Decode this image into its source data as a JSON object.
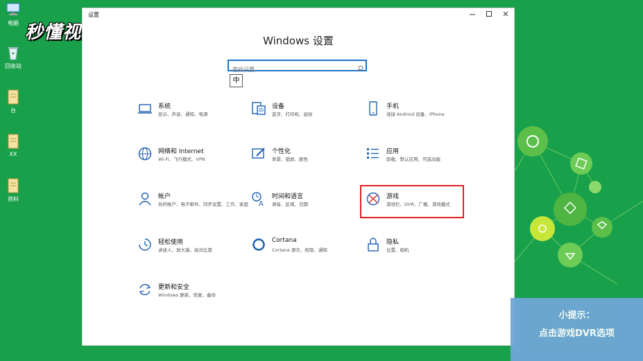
{
  "desktop": {
    "watermark": "秒懂视频",
    "icons": [
      {
        "label": "电脑"
      },
      {
        "label": "回收站"
      },
      {
        "label": "台"
      },
      {
        "label": "XX"
      },
      {
        "label": "资料"
      }
    ]
  },
  "window": {
    "title": "设置",
    "heading": "Windows 设置",
    "search_placeholder": "查找设置",
    "ime_indicator": "中",
    "items": [
      {
        "name": "系统",
        "desc": "显示、声音、通知、电源",
        "icon": "laptop-icon"
      },
      {
        "name": "设备",
        "desc": "蓝牙、打印机、鼠标",
        "icon": "keyboard-icon"
      },
      {
        "name": "手机",
        "desc": "连接 Android 设备、iPhone",
        "icon": "phone-icon"
      },
      {
        "name": "网络和 Internet",
        "desc": "Wi-Fi、飞行模式、VPN",
        "icon": "globe-icon"
      },
      {
        "name": "个性化",
        "desc": "背景、锁屏、颜色",
        "icon": "paint-icon"
      },
      {
        "name": "应用",
        "desc": "卸载、默认应用、可选功能",
        "icon": "apps-list-icon"
      },
      {
        "name": "帐户",
        "desc": "你的帐户、电子邮件、同步设置、工作、家庭",
        "icon": "person-icon"
      },
      {
        "name": "时间和语言",
        "desc": "语音、区域、日期",
        "icon": "time-language-icon"
      },
      {
        "name": "游戏",
        "desc": "游戏栏、DVR、广播、游戏模式",
        "icon": "xbox-icon"
      },
      {
        "name": "轻松使用",
        "desc": "讲述人、放大镜、高对比度",
        "icon": "ease-of-access-icon"
      },
      {
        "name": "Cortana",
        "desc": "Cortana 语言、权限、通知",
        "icon": "cortana-icon"
      },
      {
        "name": "隐私",
        "desc": "位置、相机",
        "icon": "lock-icon"
      },
      {
        "name": "更新和安全",
        "desc": "Windows 更新、恢复、备份",
        "icon": "update-icon"
      }
    ]
  },
  "tip": {
    "title": "小提示：",
    "body": "点击游戏DVR选项"
  }
}
